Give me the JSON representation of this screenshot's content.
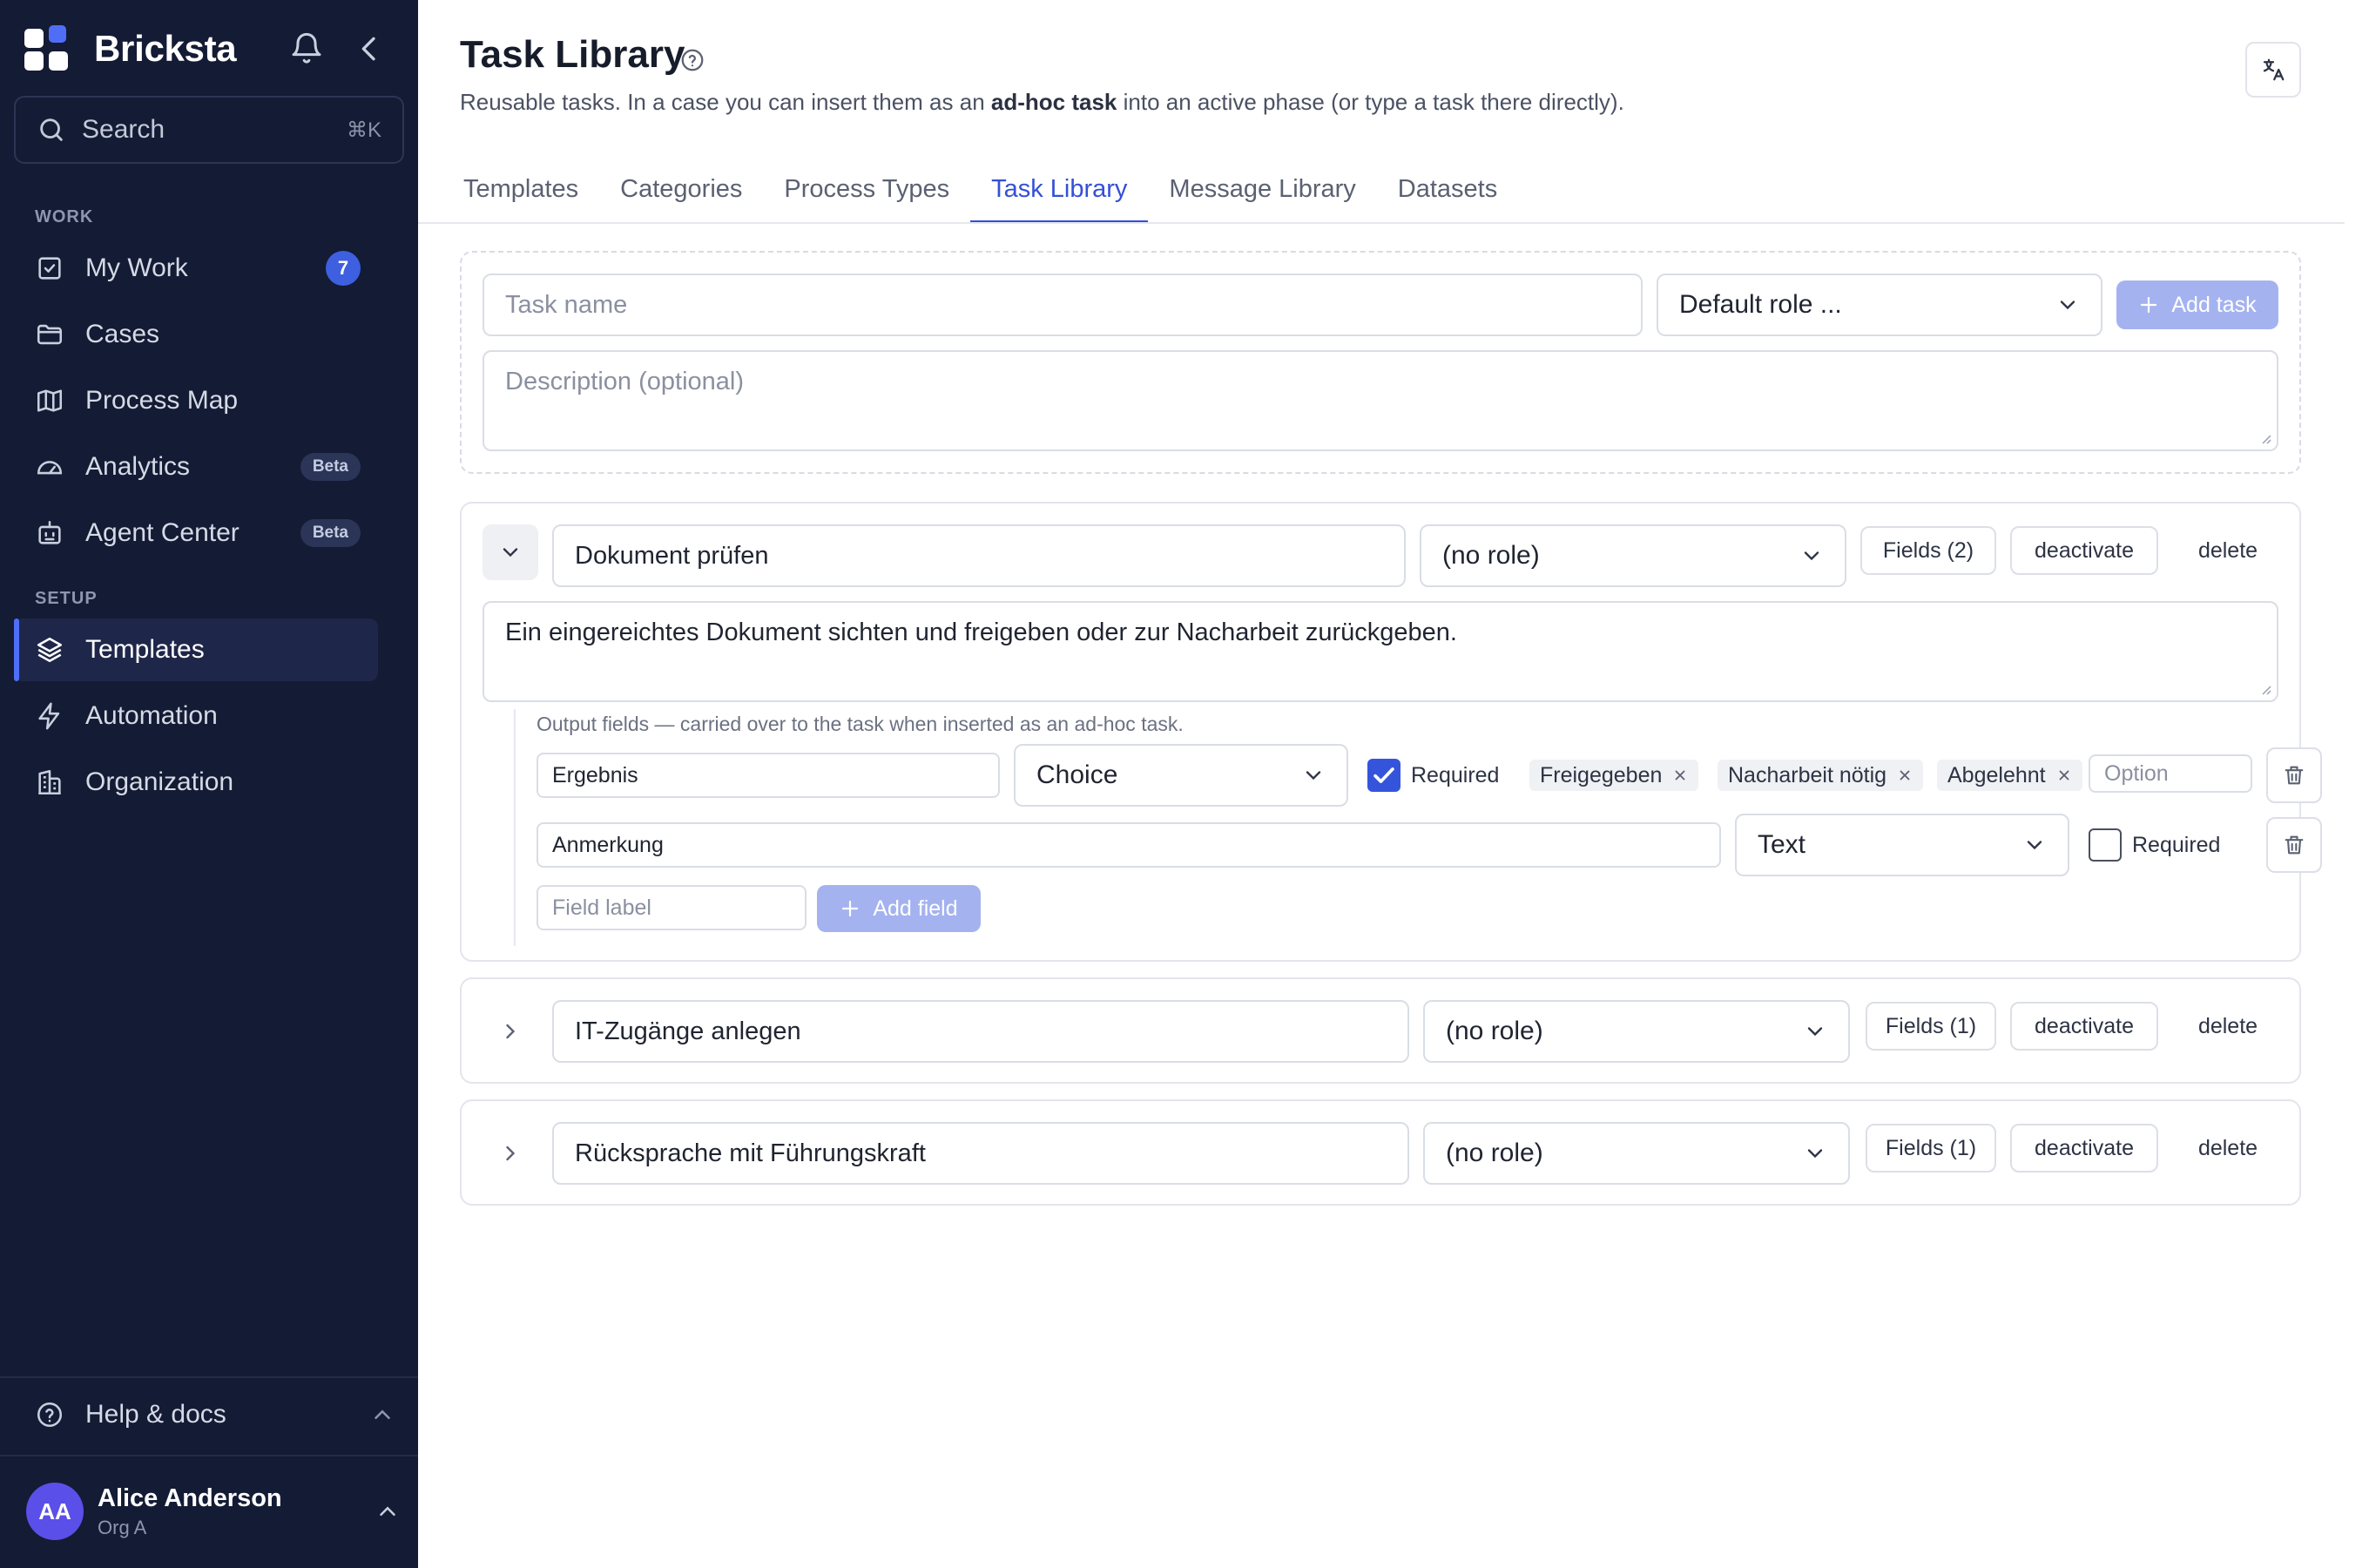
{
  "app": {
    "name": "Bricksta"
  },
  "sidebar": {
    "search": {
      "label": "Search",
      "shortcut": "⌘K"
    },
    "sections": {
      "work": "WORK",
      "setup": "SETUP"
    },
    "work_items": [
      {
        "label": "My Work",
        "icon": "check-square-icon",
        "badge": "7"
      },
      {
        "label": "Cases",
        "icon": "folder-icon"
      },
      {
        "label": "Process Map",
        "icon": "map-icon"
      },
      {
        "label": "Analytics",
        "icon": "gauge-icon",
        "badge": "Beta"
      },
      {
        "label": "Agent Center",
        "icon": "robot-icon",
        "badge": "Beta"
      }
    ],
    "setup_items": [
      {
        "label": "Templates",
        "icon": "layers-icon",
        "active": true
      },
      {
        "label": "Automation",
        "icon": "bolt-icon"
      },
      {
        "label": "Organization",
        "icon": "building-icon"
      }
    ],
    "help": {
      "label": "Help & docs",
      "icon": "help-circle-icon"
    },
    "user": {
      "initials": "AA",
      "name": "Alice Anderson",
      "org": "Org A"
    }
  },
  "page": {
    "title": "Task Library",
    "subtitle_pre": "Reusable tasks. In a case you can insert them as an ",
    "subtitle_bold": "ad-hoc task",
    "subtitle_post": " into an active phase (or type a task there directly)."
  },
  "tabs": [
    {
      "label": "Templates"
    },
    {
      "label": "Categories"
    },
    {
      "label": "Process Types"
    },
    {
      "label": "Task Library",
      "active": true
    },
    {
      "label": "Message Library"
    },
    {
      "label": "Datasets"
    }
  ],
  "new_task": {
    "name_placeholder": "Task name",
    "role_placeholder": "Default role ...",
    "add_label": "Add task",
    "description_placeholder": "Description (optional)"
  },
  "tasks": [
    {
      "name": "Dokument prüfen",
      "role": "(no role)",
      "fields_label": "Fields (2)",
      "deactivate_label": "deactivate",
      "delete_label": "delete",
      "expanded": true,
      "description": "Ein eingereichtes Dokument sichten und freigeben oder zur Nacharbeit zurückgeben.",
      "fields_caption": "Output fields — carried over to the task when inserted as an ad-hoc task.",
      "fields": [
        {
          "label": "Ergebnis",
          "type": "Choice",
          "required": true,
          "required_label": "Required",
          "options": [
            "Freigegeben",
            "Nacharbeit nötig",
            "Abgelehnt"
          ],
          "option_placeholder": "Option"
        },
        {
          "label": "Anmerkung",
          "type": "Text",
          "required": false,
          "required_label": "Required"
        }
      ],
      "field_label_placeholder": "Field label",
      "add_field_label": "Add field"
    },
    {
      "name": "IT-Zugänge anlegen",
      "role": "(no role)",
      "fields_label": "Fields (1)",
      "deactivate_label": "deactivate",
      "delete_label": "delete",
      "expanded": false
    },
    {
      "name": "Rücksprache mit Führungskraft",
      "role": "(no role)",
      "fields_label": "Fields (1)",
      "deactivate_label": "deactivate",
      "delete_label": "delete",
      "expanded": false
    }
  ],
  "colors": {
    "sidebar_bg": "#141b34",
    "accent": "#3450d6",
    "primary_button_disabled": "#a4b3ef"
  }
}
